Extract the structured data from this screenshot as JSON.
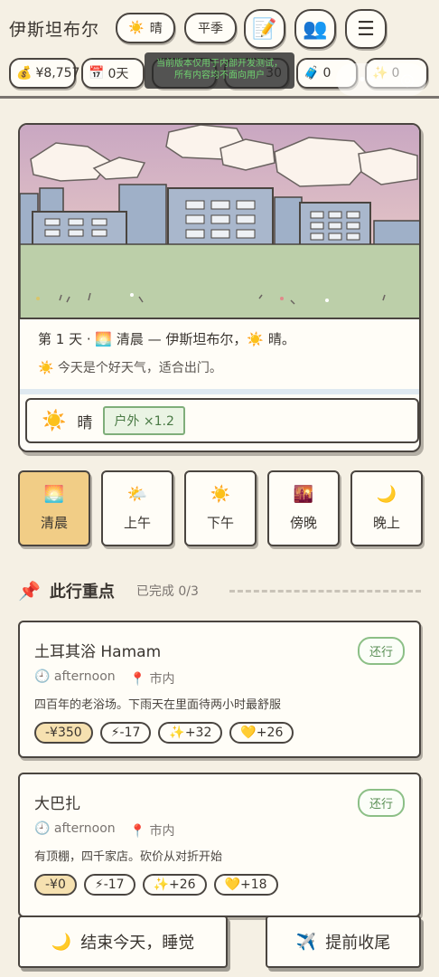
{
  "header": {
    "city": "伊斯坦布尔",
    "weather_icon": "sun-icon",
    "weather": "晴",
    "season": "平季",
    "notes_icon": "memo-icon",
    "companions_icon": "people-icon",
    "menu_icon": "hamburger-icon"
  },
  "stats": {
    "money": "¥8,757",
    "days": "0天",
    "stat3": "",
    "stat4": "30",
    "luggage": "0",
    "sparkle": "0"
  },
  "toast": {
    "line1": "当前版本仅用于内部开发测试，",
    "line2": "所有内容均不面向用户"
  },
  "scene": {
    "narration_day": "第 1 天 · ",
    "narration_rest": " 清晨 — 伊斯坦布尔，",
    "narration_end": " 晴。",
    "sub": "今天是个好天气，适合出门。",
    "weather_label": "晴",
    "chip": "户外 ×1.2"
  },
  "time_slots": [
    {
      "label": "清晨",
      "icon": "sunrise-icon"
    },
    {
      "label": "上午",
      "icon": "partly-cloudy-icon"
    },
    {
      "label": "下午",
      "icon": "sun-icon"
    },
    {
      "label": "傍晚",
      "icon": "sunset-city-icon"
    },
    {
      "label": "晚上",
      "icon": "moon-icon"
    }
  ],
  "section": {
    "title": "此行重点",
    "done": "已完成 0/3"
  },
  "spots": [
    {
      "name": "土耳其浴 Hamam",
      "status": "还行",
      "time": "afternoon",
      "area": "市内",
      "desc": "四百年的老浴场。下雨天在里面待两小时最舒服",
      "cost": "-¥350",
      "energy": "⚡-17",
      "spark": "✨+32",
      "heart": "💛+26"
    },
    {
      "name": "大巴扎",
      "status": "还行",
      "time": "afternoon",
      "area": "市内",
      "desc": "有顶棚，四千家店。砍价从对折开始",
      "cost": "-¥0",
      "energy": "⚡-17",
      "spark": "✨+26",
      "heart": "💛+18"
    }
  ],
  "bottom": {
    "sleep": "结束今天，睡觉",
    "finish": "提前收尾"
  }
}
